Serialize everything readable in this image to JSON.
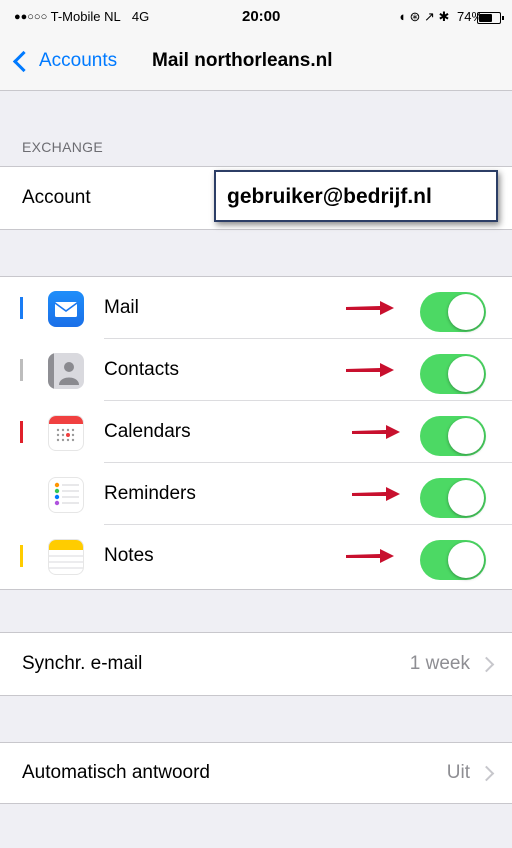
{
  "status_bar": {
    "carrier_dots": "●●○○○",
    "carrier": "T-Mobile NL",
    "network": "4G",
    "time": "20:00",
    "right_icons": "◖ ⊛ ↗ ✱",
    "battery": "74%",
    "battery_level": 0.74
  },
  "nav": {
    "back_label": "Accounts",
    "title": "Mail northorleans.nl"
  },
  "exchange": {
    "section_header": "EXCHANGE",
    "account_label": "Account",
    "account_value": "gebruiker@bedrijf.nl"
  },
  "services": [
    {
      "label": "Mail",
      "icon": "mail-icon",
      "on": true
    },
    {
      "label": "Contacts",
      "icon": "contacts-icon",
      "on": true
    },
    {
      "label": "Calendars",
      "icon": "calendar-icon",
      "on": true
    },
    {
      "label": "Reminders",
      "icon": "reminders-icon",
      "on": true
    },
    {
      "label": "Notes",
      "icon": "notes-icon",
      "on": true
    }
  ],
  "sync": {
    "label": "Synchr. e-mail",
    "value": "1 week"
  },
  "auto_reply": {
    "label": "Automatisch antwoord",
    "value": "Uit"
  },
  "colors": {
    "accent": "#007aff",
    "toggle_on": "#4cd964",
    "arrow": "#c8102e"
  }
}
